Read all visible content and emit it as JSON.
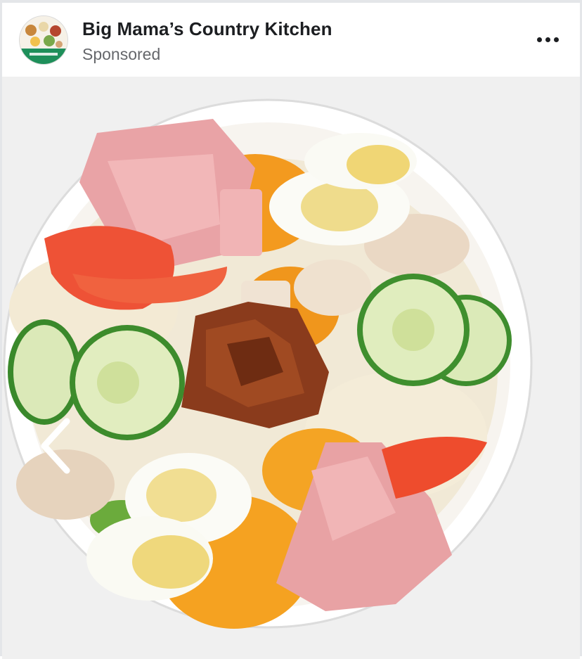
{
  "post": {
    "page_name": "Big Mama’s Country Kitchen",
    "sponsored_label": "Sponsored",
    "avatar_icon": "restaurant-logo-icon",
    "more_icon": "more-options-icon"
  },
  "carousel": {
    "prev_icon": "chevron-left-icon",
    "image_subject": "chef-salad-bowl"
  },
  "colors": {
    "page_name": "#1c1e21",
    "sponsored": "#65676b",
    "border": "#e4e6e9"
  }
}
